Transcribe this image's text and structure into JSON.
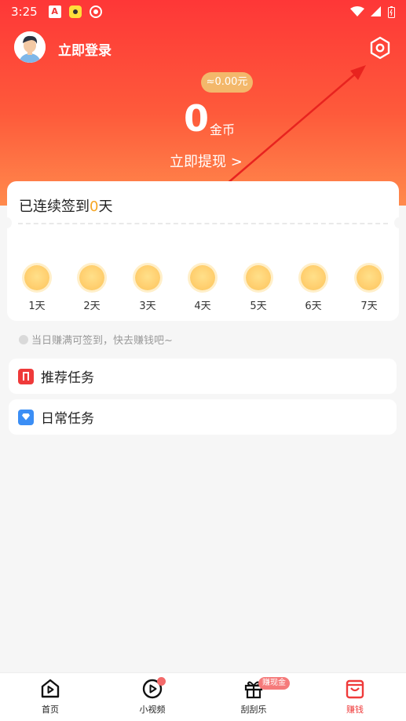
{
  "status_bar": {
    "time": "3:25"
  },
  "header": {
    "login_label": "立即登录",
    "cash_approx": "≈0.00元",
    "coin_amount": "0",
    "coin_unit": "金币",
    "withdraw_label": "立即提现 >"
  },
  "signin": {
    "title_prefix": "已连续签到",
    "days_count": "0",
    "title_suffix": "天",
    "days": [
      "1天",
      "2天",
      "3天",
      "4天",
      "5天",
      "6天",
      "7天"
    ]
  },
  "tip": "当日赚满可签到，快去赚钱吧~",
  "tasks": [
    {
      "label": "推荐任务",
      "icon": "bookmark-icon"
    },
    {
      "label": "日常任务",
      "icon": "diamond-icon"
    }
  ],
  "tabbar": {
    "items": [
      {
        "label": "首页",
        "icon": "home-play-icon"
      },
      {
        "label": "小视频",
        "icon": "play-circle-icon"
      },
      {
        "label": "刮刮乐",
        "icon": "gift-icon",
        "badge": "赚现金"
      },
      {
        "label": "赚钱",
        "icon": "wallet-bag-icon"
      }
    ],
    "active": "赚钱"
  },
  "colors": {
    "hero_top": "#fe3737",
    "hero_bottom": "#ff8a4c",
    "accent": "#ef3a3a",
    "signin_count": "#f6a623",
    "cash_pill": "#f3b86b",
    "annotation_arrow": "#e8231f"
  }
}
